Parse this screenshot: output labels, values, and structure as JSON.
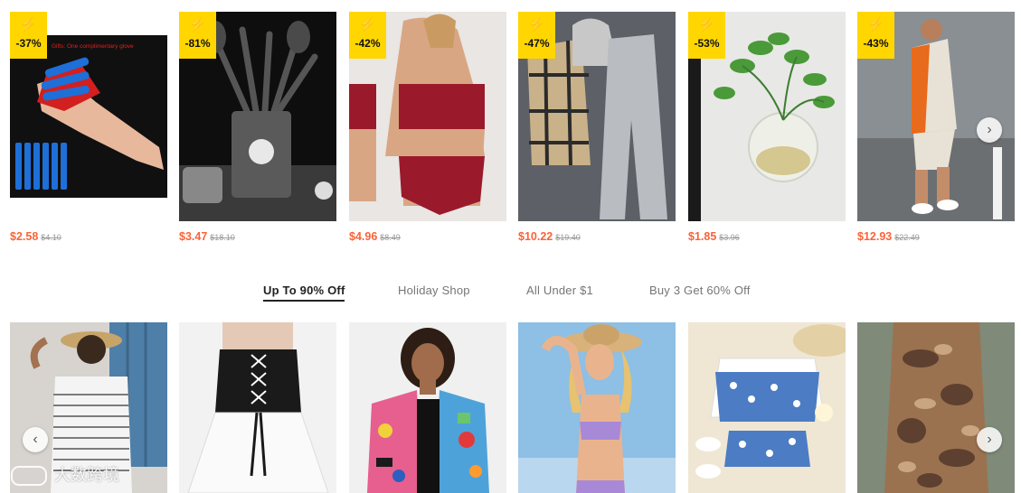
{
  "top_products": [
    {
      "discount": "-37%",
      "price": "$2.58",
      "old_price": "$4.10",
      "image_text": "Gifts: One complimentary glove"
    },
    {
      "discount": "-81%",
      "price": "$3.47",
      "old_price": "$18.10"
    },
    {
      "discount": "-42%",
      "price": "$4.96",
      "old_price": "$8.49"
    },
    {
      "discount": "-47%",
      "price": "$10.22",
      "old_price": "$19.40"
    },
    {
      "discount": "-53%",
      "price": "$1.85",
      "old_price": "$3.96"
    },
    {
      "discount": "-43%",
      "price": "$12.93",
      "old_price": "$22.49"
    }
  ],
  "tabs": [
    {
      "label": "Up To 90% Off",
      "active": true
    },
    {
      "label": "Holiday Shop",
      "active": false
    },
    {
      "label": "All Under $1",
      "active": false
    },
    {
      "label": "Buy 3 Get 60% Off",
      "active": false
    }
  ],
  "bottom_products": [
    {
      "name": "striped ruffle top"
    },
    {
      "name": "lace-up corset skirt set"
    },
    {
      "name": "graffiti print blazer"
    },
    {
      "name": "lilac bikini"
    },
    {
      "name": "floral kids set"
    },
    {
      "name": "tie-dye midi skirt"
    }
  ],
  "icons": {
    "bolt": "⚡",
    "next": "›",
    "prev": "‹"
  },
  "watermark": {
    "text": "大数跨境"
  },
  "colors": {
    "badge": "#ffd600",
    "price": "#fa6338",
    "old_price": "#999999"
  }
}
